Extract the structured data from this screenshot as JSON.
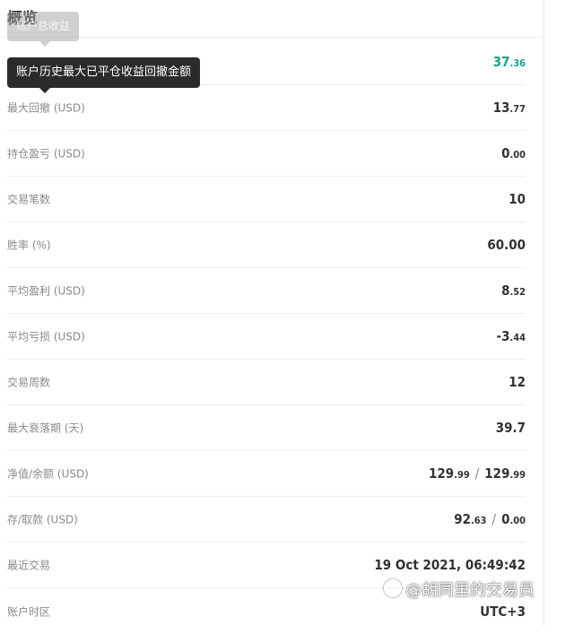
{
  "title": "概览",
  "tooltip_small": "账户总收益",
  "tooltip_main": "账户历史最大已平仓收益回撤金额",
  "rows": [
    {
      "label": "",
      "int": "37",
      "dec": ".36",
      "accent": true
    },
    {
      "label": "最大回撤 (USD)",
      "int": "13",
      "dec": ".77"
    },
    {
      "label": "持仓盈亏 (USD)",
      "int": "0",
      "dec": ".00"
    },
    {
      "label": "交易笔数",
      "int": "10",
      "dec": ""
    },
    {
      "label": "胜率 (%)",
      "int": "60.00",
      "dec": ""
    },
    {
      "label": "平均盈利 (USD)",
      "int": "8",
      "dec": ".52"
    },
    {
      "label": "平均亏损 (USD)",
      "int": "-3",
      "dec": ".44"
    },
    {
      "label": "交易周数",
      "int": "12",
      "dec": ""
    },
    {
      "label": "最大衰落期 (天)",
      "int": "39.7",
      "dec": ""
    },
    {
      "label": "净值/余额 (USD)",
      "int": "129",
      "dec": ".99",
      "int2": "129",
      "dec2": ".99"
    },
    {
      "label": "存/取款 (USD)",
      "int": "92",
      "dec": ".63",
      "int2": "0",
      "dec2": ".00"
    },
    {
      "label": "最近交易",
      "int": "19 Oct 2021, 06:49:42",
      "dec": ""
    },
    {
      "label": "账户时区",
      "int": "UTC+3",
      "dec": ""
    }
  ],
  "separator": "/",
  "watermark": "@胡同里的交易员",
  "colors": {
    "accent": "#1aa08c",
    "tooltip_bg": "#2b2b2b"
  }
}
